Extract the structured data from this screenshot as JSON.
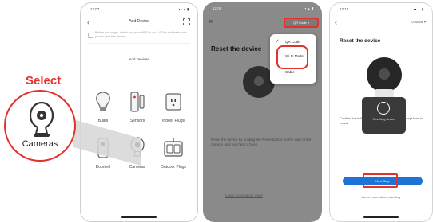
{
  "callout": {
    "title": "Select",
    "label": "Cameras",
    "accent": "#e4312b"
  },
  "phone1": {
    "status_time": "12:07",
    "status_icons": "▪▪ ▴ ▮",
    "title": "Add Device",
    "banner": "Before you begin, check that your Wi-Fi is on 2.4GHz and have your phone near the device",
    "section": "Add Devices",
    "devices": [
      {
        "label": "Bulbs",
        "icon": "bulb-icon"
      },
      {
        "label": "Sensors",
        "icon": "sensor-icon"
      },
      {
        "label": "Indoor Plugs",
        "icon": "plug-icon"
      },
      {
        "label": "Doorbell",
        "icon": "doorbell-icon"
      },
      {
        "label": "Cameras",
        "icon": "camera-icon"
      },
      {
        "label": "Outdoor Plugs",
        "icon": "outdoor-plug-icon"
      }
    ]
  },
  "phone2": {
    "status_time": "12:08",
    "status_icons": "▪▪ ▴ ▮",
    "title": "Reset the device",
    "wifi_button": "QR Code ▾",
    "dropdown": [
      {
        "label": "QR Code",
        "checked": true
      },
      {
        "label": "Wi-Fi Mode",
        "checked": false
      },
      {
        "label": "Cable",
        "checked": false
      }
    ],
    "description": "Reset the device by holding the Reset button on the side of the camera until you hear a beep",
    "link": "Learn more about reset"
  },
  "phone3": {
    "status_time": "12:10",
    "status_icons": "▪▪ ▴ ▮",
    "header_right": "EZ Mode ▾",
    "title": "Reset the device",
    "toast": "Resetting device",
    "description": "Confirm the indicator light blinks rapidly or a prompt tone is heard",
    "next_button": "Next Step",
    "link": "Learn more about resetting"
  }
}
